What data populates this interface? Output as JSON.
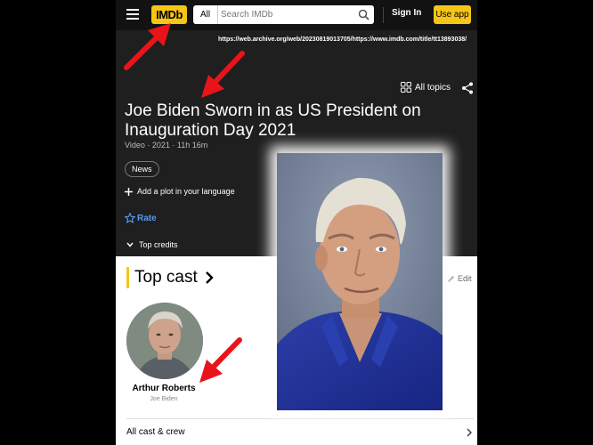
{
  "nav": {
    "logo": "IMDb",
    "search_category": "All",
    "search_placeholder": "Search IMDb",
    "sign_in": "Sign In",
    "use_app": "Use app"
  },
  "archive_url": "https://web.archive.org/web/20230819013705/https://www.imdb.com/title/tt13893038/",
  "hero": {
    "all_topics": "All topics",
    "title": "Joe Biden Sworn in as US President on Inauguration Day 2021",
    "meta": "Video · 2021 · 11h 16m",
    "genre_chip": "News",
    "add_plot": "Add a plot in your language",
    "rate": "Rate",
    "top_credits": "Top credits"
  },
  "cast": {
    "heading": "Top cast",
    "edit": "Edit",
    "actor_name": "Arthur Roberts",
    "actor_role": "Joe Biden",
    "all_cast": "All cast & crew"
  },
  "colors": {
    "accent": "#f5c518",
    "link_blue": "#5799ef",
    "arrow_red": "#e8141a"
  },
  "icons": [
    "menu-icon",
    "search-icon",
    "grid-icon",
    "share-icon",
    "plus-icon",
    "star-icon",
    "chevron-down-icon",
    "chevron-right-icon",
    "pencil-icon",
    "arrow-annotation"
  ]
}
